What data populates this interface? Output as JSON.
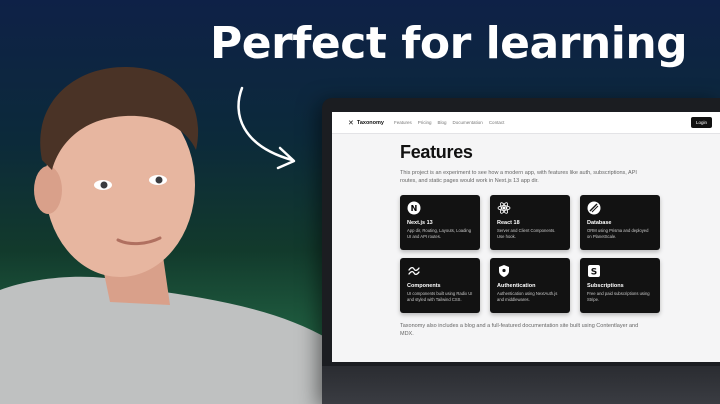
{
  "headline": "Perfect for learning",
  "site": {
    "logo_text": "Taxonomy",
    "nav": [
      "Features",
      "Pricing",
      "Blog",
      "Documentation",
      "Contact"
    ],
    "login_label": "Login",
    "page_title": "Features",
    "intro": "This project is an experiment to see how a modern app, with features like auth, subscriptions, API routes, and static pages would work in Next.js 13 app dir.",
    "cards": [
      {
        "icon": "nextjs-icon",
        "title": "Next.js 13",
        "desc": "App dir, Routing, Layouts, Loading UI and API routes."
      },
      {
        "icon": "react-icon",
        "title": "React 18",
        "desc": "Server and Client Components. Use hook."
      },
      {
        "icon": "database-icon",
        "title": "Database",
        "desc": "ORM using Prisma and deployed on PlanetScale."
      },
      {
        "icon": "tailwind-icon",
        "title": "Components",
        "desc": "UI components built using Radix UI and styled with Tailwind CSS."
      },
      {
        "icon": "shield-icon",
        "title": "Authentication",
        "desc": "Authentication using NextAuth.js and middlewares."
      },
      {
        "icon": "stripe-icon",
        "title": "Subscriptions",
        "desc": "Free and paid subscriptions using Stripe."
      }
    ],
    "footer_note": "Taxonomy also includes a blog and a full-featured documentation site built using Contentlayer and MDX."
  }
}
